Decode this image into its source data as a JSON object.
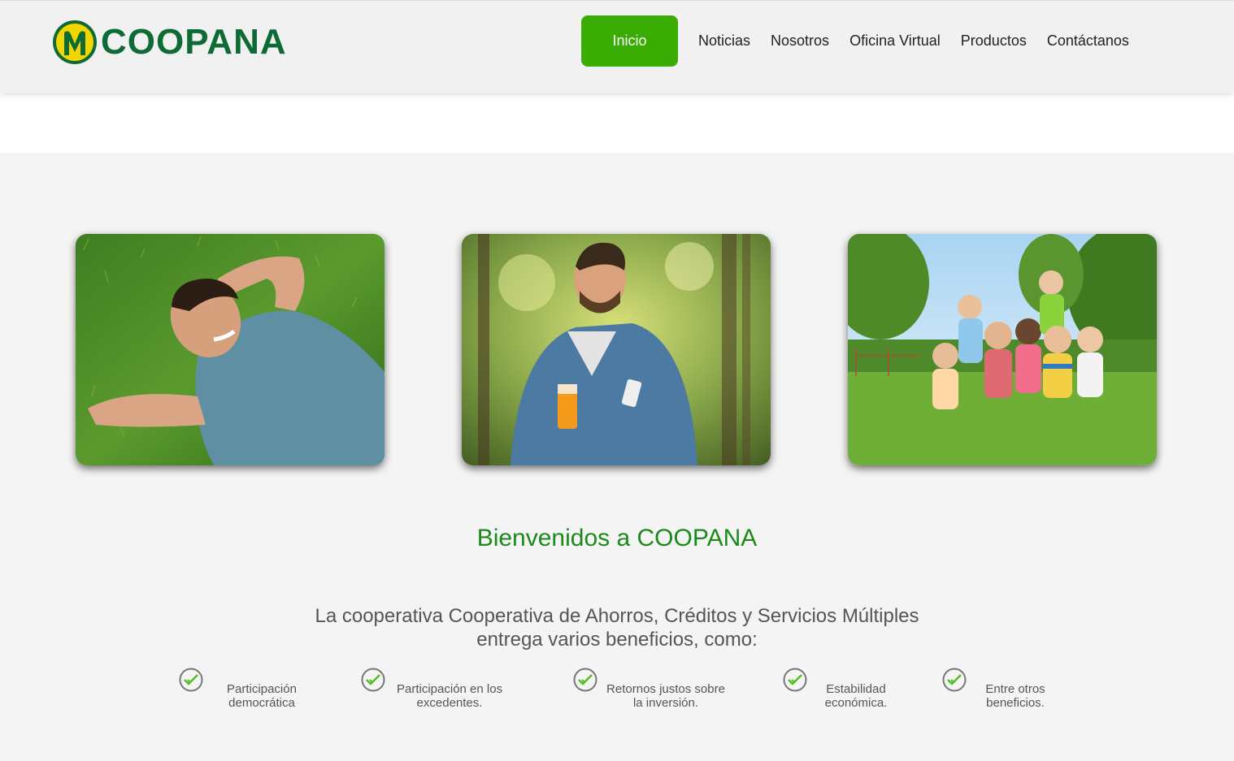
{
  "brand": {
    "name": "COOPANA"
  },
  "nav": {
    "active": "Inicio",
    "items": [
      "Noticias",
      "Nosotros",
      "Oficina Virtual",
      "Productos",
      "Contáctanos"
    ]
  },
  "colors": {
    "brand_green": "#0f6b35",
    "accent_green": "#3aad05",
    "heading_green": "#1b8a1b",
    "logo_yellow": "#f2d600"
  },
  "gallery": [
    {
      "name": "man-lying-on-grass-photo"
    },
    {
      "name": "man-with-phone-and-juice-photo"
    },
    {
      "name": "children-in-park-photo"
    }
  ],
  "welcome": {
    "title": "Bienvenidos a COOPANA",
    "intro_line1": "La cooperativa Cooperativa de Ahorros, Créditos y Servicios Múltiples",
    "intro_line2": "entrega varios beneficios, como:"
  },
  "benefits": [
    {
      "line1": "Participación",
      "line2": "democrática"
    },
    {
      "line1": "Participación en los",
      "line2": "excedentes."
    },
    {
      "line1": "Retornos justos sobre",
      "line2": "la inversión."
    },
    {
      "line1": "Estabilidad",
      "line2": "económica."
    },
    {
      "line1": "Entre otros",
      "line2": "beneficios."
    }
  ]
}
